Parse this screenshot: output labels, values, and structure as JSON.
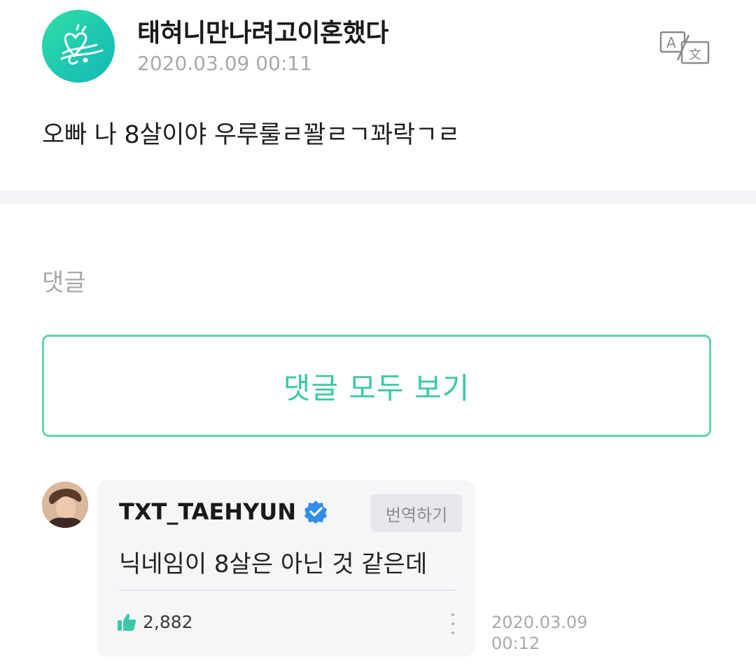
{
  "post": {
    "author": "태혀니만나려고이혼했다",
    "timestamp": "2020.03.09 00:11",
    "body": "오빠 나 8살이야 우루룰ㄹ꽐ㄹㄱ꽈락ㄱㄹ"
  },
  "comments": {
    "heading": "댓글",
    "view_all_label": "댓글 모두 보기",
    "items": [
      {
        "author": "TXT_TAEHYUN",
        "verified": true,
        "translate_label": "번역하기",
        "text": "닉네임이 8살은 아닌 것 같은데",
        "likes": "2,882",
        "date": "2020.03.09",
        "time": "00:12"
      }
    ]
  },
  "colors": {
    "accent": "#3cc8a6",
    "button_border": "#5fd3b3",
    "verified_blue": "#2f8fe8",
    "muted_text": "#a9a9a9"
  },
  "icons": {
    "translate": "translate-icon",
    "verified": "verified-badge-icon",
    "like": "thumbs-up-icon",
    "more": "more-vertical-icon"
  }
}
